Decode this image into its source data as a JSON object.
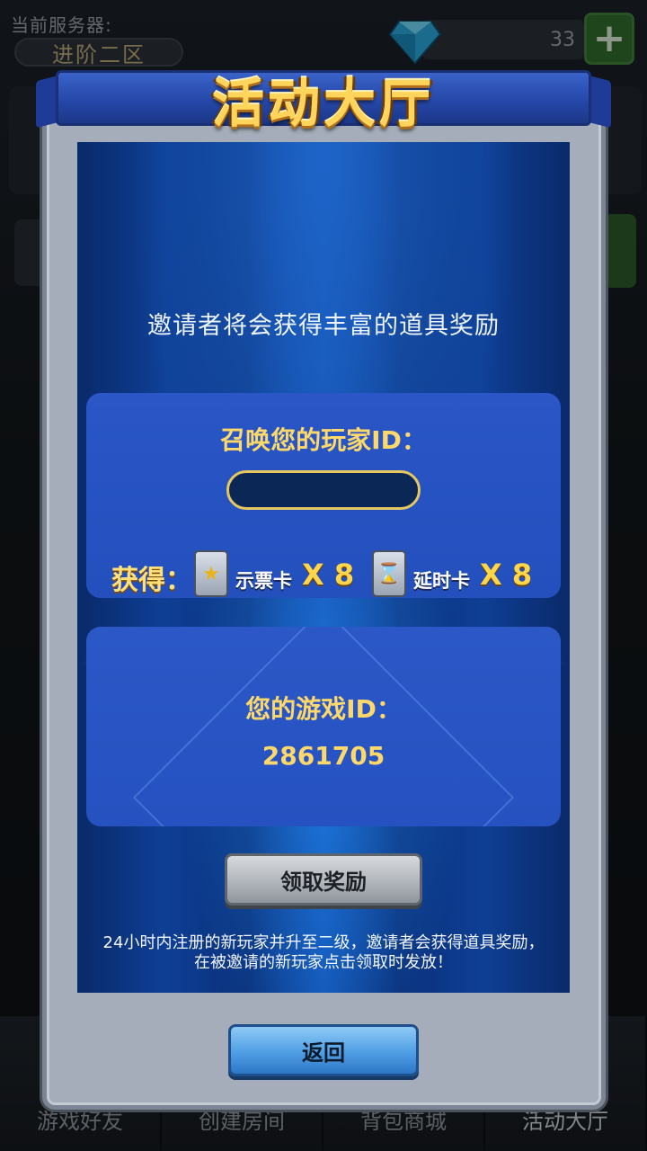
{
  "background": {
    "server_label": "当前服务器:",
    "server_name": "进阶二区",
    "gem_count": "33",
    "plus_label": "+",
    "tabs": [
      {
        "label": "游戏好友"
      },
      {
        "label": "创建房间"
      },
      {
        "label": "背包商城"
      },
      {
        "label": "活动大厅"
      }
    ]
  },
  "modal": {
    "title": "活动大厅",
    "subtitle": "邀请者将会获得丰富的道具奖励",
    "invite": {
      "heading": "召唤您的玩家ID：",
      "input_value": "",
      "input_placeholder": "",
      "reward_label": "获得：",
      "rewards": [
        {
          "name": "示票卡",
          "count": "X 8",
          "icon": "vote-card-icon"
        },
        {
          "name": "延时卡",
          "count": "X 8",
          "icon": "time-card-icon"
        }
      ]
    },
    "my_id": {
      "heading": "您的游戏ID：",
      "value": "2861705"
    },
    "claim_button": "领取奖励",
    "note_line1": "24小时内注册的新玩家并升至二级，邀请者会获得道具奖励，",
    "note_line2": "在被邀请的新玩家点击领取时发放！",
    "back_button": "返回"
  },
  "colors": {
    "accent_gold": "#ffd86a",
    "panel_blue": "#2a56c6",
    "modal_frame": "#a5adba"
  }
}
